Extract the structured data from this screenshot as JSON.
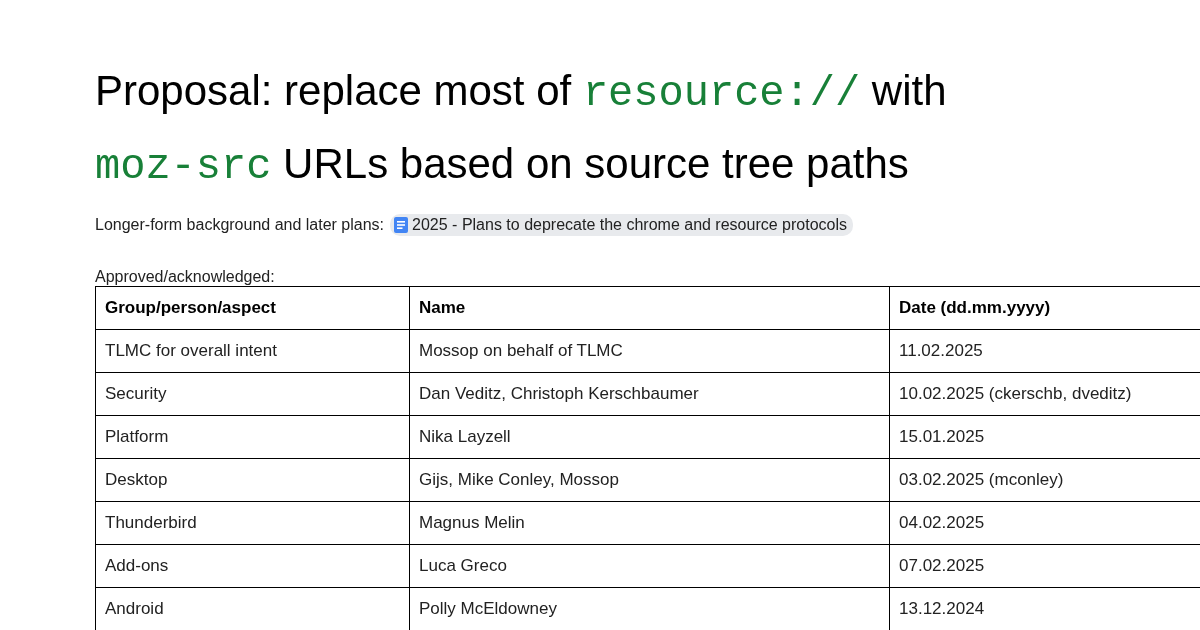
{
  "title": [
    {
      "kind": "text",
      "text": "Proposal: replace most of "
    },
    {
      "kind": "code",
      "text": "resource://"
    },
    {
      "kind": "text",
      "text": " with "
    },
    {
      "kind": "code",
      "text": "moz-src"
    },
    {
      "kind": "text",
      "text": " URLs based on source tree paths"
    }
  ],
  "background": {
    "label": "Longer-form background and later plans:",
    "link": "2025 - Plans to deprecate the chrome and resource protocols"
  },
  "table_caption": "Approved/acknowledged:",
  "table": {
    "columns": [
      "Group/person/aspect",
      "Name",
      "Date (dd.mm.yyyy)"
    ],
    "rows": [
      [
        "TLMC for overall intent",
        "Mossop on behalf of TLMC",
        "11.02.2025"
      ],
      [
        "Security",
        "Dan Veditz, Christoph Kerschbaumer",
        "10.02.2025 (ckerschb, dveditz)"
      ],
      [
        "Platform",
        "Nika Layzell",
        "15.01.2025"
      ],
      [
        "Desktop",
        "Gijs, Mike Conley, Mossop",
        "03.02.2025 (mconley)"
      ],
      [
        "Thunderbird",
        "Magnus Melin",
        "04.02.2025"
      ],
      [
        "Add-ons",
        "Luca Greco",
        "07.02.2025"
      ],
      [
        "Android",
        "Polly McEldowney",
        "13.12.2024"
      ]
    ]
  }
}
